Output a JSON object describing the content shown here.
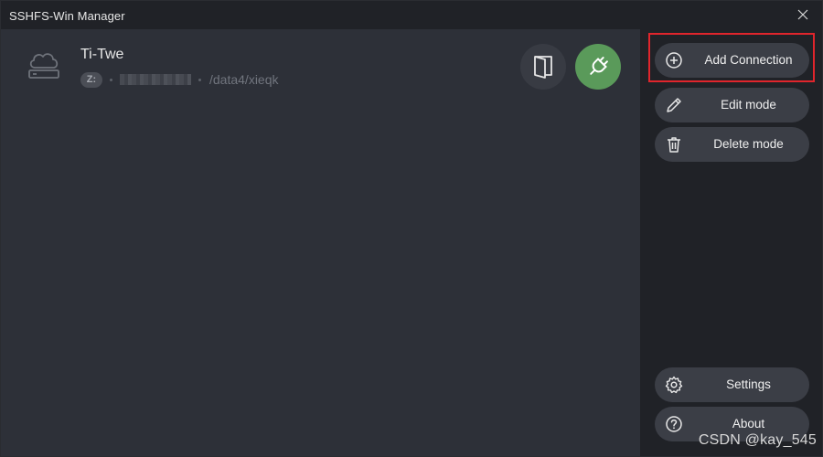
{
  "window": {
    "title": "SSHFS-Win Manager"
  },
  "connection": {
    "name": "Ti-Twe",
    "drive_letter": "Z:",
    "path": "/data4/xieqk",
    "host_hidden": true
  },
  "sidebar": {
    "add_connection_label": "Add Connection",
    "edit_mode_label": "Edit mode",
    "delete_mode_label": "Delete mode",
    "settings_label": "Settings",
    "about_label": "About"
  },
  "watermark": {
    "text": "CSDN @kay_545"
  },
  "colors": {
    "accent_green": "#5a9a5a",
    "highlight_red": "#e0252c",
    "sidebar_bg": "#202227",
    "main_bg": "#2d3038"
  },
  "icons": {
    "close": "close-icon",
    "server": "cloud-server-icon",
    "open_folder": "folder-open-icon",
    "connect": "plug-icon",
    "add": "plus-circle-icon",
    "edit": "pencil-icon",
    "delete": "trash-icon",
    "settings": "gear-icon",
    "about": "help-circle-icon"
  }
}
